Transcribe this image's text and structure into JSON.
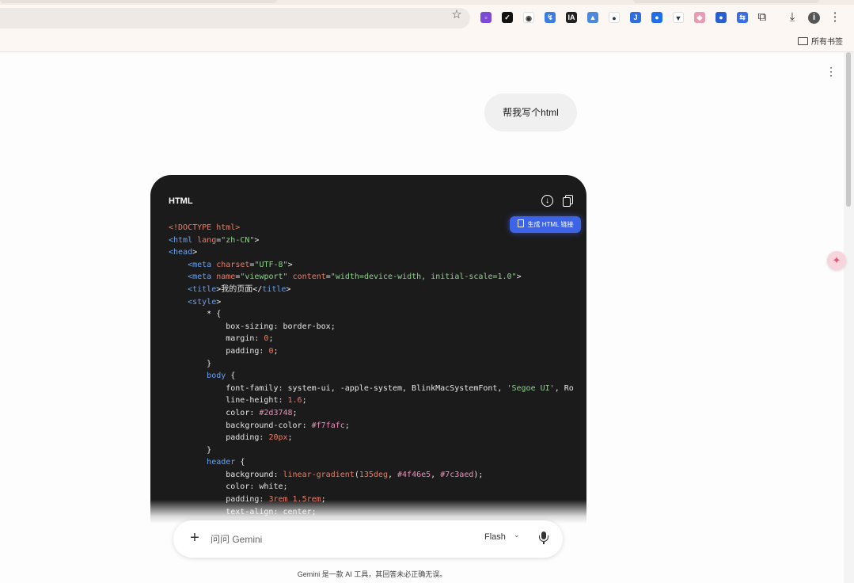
{
  "browser": {
    "bookmarks_folder_label": "所有书签",
    "extensions": [
      {
        "name": "ext-purple-icon",
        "color": "#7b4bd6",
        "glyph": "▫"
      },
      {
        "name": "ext-check-icon",
        "color": "#111111",
        "glyph": "✓"
      },
      {
        "name": "ext-record-icon",
        "color": "#ffffff",
        "glyph": "◉"
      },
      {
        "name": "ext-blue-icon",
        "color": "#3d7ce0",
        "glyph": "↯"
      },
      {
        "name": "ext-ia-icon",
        "color": "#222222",
        "glyph": "IA"
      },
      {
        "name": "ext-image-icon",
        "color": "#4a89dc",
        "glyph": "▲"
      },
      {
        "name": "ext-mask-icon",
        "color": "#ffffff",
        "glyph": "●"
      },
      {
        "name": "ext-j-icon",
        "color": "#2f6de0",
        "glyph": "J"
      },
      {
        "name": "ext-chrome-blue-icon",
        "color": "#1f6feb",
        "glyph": "●"
      },
      {
        "name": "ext-v-icon",
        "color": "#ffffff",
        "glyph": "▼"
      },
      {
        "name": "ext-pink-icon",
        "color": "#e79bb4",
        "glyph": "◈"
      },
      {
        "name": "ext-globe-icon",
        "color": "#2b5fd0",
        "glyph": "●"
      },
      {
        "name": "ext-translate-icon",
        "color": "#3a6ee8",
        "glyph": "⇆"
      }
    ]
  },
  "chat": {
    "user_message": "帮我写个html"
  },
  "code_block": {
    "language_label": "HTML",
    "generate_link_label": "生成 HTML 链接",
    "lines": [
      [
        {
          "t": "kw",
          "v": "<!DOCTYPE html>"
        }
      ],
      [
        {
          "t": "tag",
          "v": "<html"
        },
        {
          "t": "plain",
          "v": " "
        },
        {
          "t": "attr",
          "v": "lang"
        },
        {
          "t": "plain",
          "v": "="
        },
        {
          "t": "str",
          "v": "\"zh-CN\""
        },
        {
          "t": "plain",
          "v": ">"
        }
      ],
      [
        {
          "t": "tag",
          "v": "<head"
        },
        {
          "t": "plain",
          "v": ">"
        }
      ],
      [
        {
          "t": "plain",
          "v": "    "
        },
        {
          "t": "tag",
          "v": "<meta"
        },
        {
          "t": "plain",
          "v": " "
        },
        {
          "t": "attr",
          "v": "charset"
        },
        {
          "t": "plain",
          "v": "="
        },
        {
          "t": "str",
          "v": "\"UTF-8\""
        },
        {
          "t": "plain",
          "v": ">"
        }
      ],
      [
        {
          "t": "plain",
          "v": "    "
        },
        {
          "t": "tag",
          "v": "<meta"
        },
        {
          "t": "plain",
          "v": " "
        },
        {
          "t": "attr",
          "v": "name"
        },
        {
          "t": "plain",
          "v": "="
        },
        {
          "t": "str",
          "v": "\"viewport\""
        },
        {
          "t": "plain",
          "v": " "
        },
        {
          "t": "attr",
          "v": "content"
        },
        {
          "t": "plain",
          "v": "="
        },
        {
          "t": "str",
          "v": "\"width=device-width, initial-scale=1.0\""
        },
        {
          "t": "plain",
          "v": ">"
        }
      ],
      [
        {
          "t": "plain",
          "v": "    "
        },
        {
          "t": "tag",
          "v": "<title"
        },
        {
          "t": "plain",
          "v": ">我的页面</"
        },
        {
          "t": "tag",
          "v": "title"
        },
        {
          "t": "plain",
          "v": ">"
        }
      ],
      [
        {
          "t": "plain",
          "v": "    "
        },
        {
          "t": "tag",
          "v": "<style"
        },
        {
          "t": "plain",
          "v": ">"
        }
      ],
      [
        {
          "t": "plain",
          "v": "        * {"
        }
      ],
      [
        {
          "t": "plain",
          "v": "            box-sizing: border-box;"
        }
      ],
      [
        {
          "t": "plain",
          "v": "            margin: "
        },
        {
          "t": "num",
          "v": "0"
        },
        {
          "t": "plain",
          "v": ";"
        }
      ],
      [
        {
          "t": "plain",
          "v": "            padding: "
        },
        {
          "t": "num",
          "v": "0"
        },
        {
          "t": "plain",
          "v": ";"
        }
      ],
      [
        {
          "t": "plain",
          "v": "        }"
        }
      ],
      [
        {
          "t": "plain",
          "v": "        "
        },
        {
          "t": "tag",
          "v": "body"
        },
        {
          "t": "plain",
          "v": " {"
        }
      ],
      [
        {
          "t": "plain",
          "v": "            font-family: system-ui, -apple-system, BlinkMacSystemFont, "
        },
        {
          "t": "str",
          "v": "'Segoe UI'"
        },
        {
          "t": "plain",
          "v": ", Ro"
        }
      ],
      [
        {
          "t": "plain",
          "v": "            line-height: "
        },
        {
          "t": "num",
          "v": "1.6"
        },
        {
          "t": "plain",
          "v": ";"
        }
      ],
      [
        {
          "t": "plain",
          "v": "            color: "
        },
        {
          "t": "col",
          "v": "#2d3748"
        },
        {
          "t": "plain",
          "v": ";"
        }
      ],
      [
        {
          "t": "plain",
          "v": "            background-color: "
        },
        {
          "t": "col",
          "v": "#f7fafc"
        },
        {
          "t": "plain",
          "v": ";"
        }
      ],
      [
        {
          "t": "plain",
          "v": "            padding: "
        },
        {
          "t": "num",
          "v": "20px"
        },
        {
          "t": "plain",
          "v": ";"
        }
      ],
      [
        {
          "t": "plain",
          "v": "        }"
        }
      ],
      [
        {
          "t": "plain",
          "v": "        "
        },
        {
          "t": "tag",
          "v": "header"
        },
        {
          "t": "plain",
          "v": " {"
        }
      ],
      [
        {
          "t": "plain",
          "v": "            background: "
        },
        {
          "t": "fn",
          "v": "linear-gradient"
        },
        {
          "t": "plain",
          "v": "("
        },
        {
          "t": "num",
          "v": "135deg"
        },
        {
          "t": "plain",
          "v": ", "
        },
        {
          "t": "col",
          "v": "#4f46e5"
        },
        {
          "t": "plain",
          "v": ", "
        },
        {
          "t": "col",
          "v": "#7c3aed"
        },
        {
          "t": "plain",
          "v": ");"
        }
      ],
      [
        {
          "t": "plain",
          "v": "            color: white;"
        }
      ],
      [
        {
          "t": "plain",
          "v": "            padding: "
        },
        {
          "t": "num",
          "v": "3rem 1.5rem"
        },
        {
          "t": "plain",
          "v": ";"
        }
      ],
      [
        {
          "t": "plain",
          "v": "            text-align: center;"
        }
      ]
    ]
  },
  "composer": {
    "placeholder": "问问 Gemini",
    "model_label": "Flash"
  },
  "footer": {
    "disclaimer": "Gemini 是一款 AI 工具，其回答未必正确无误。"
  },
  "colors": {
    "accent_button": "#3d63e6",
    "code_background": "#1b1b1c",
    "user_bubble": "#f0f0f0"
  }
}
